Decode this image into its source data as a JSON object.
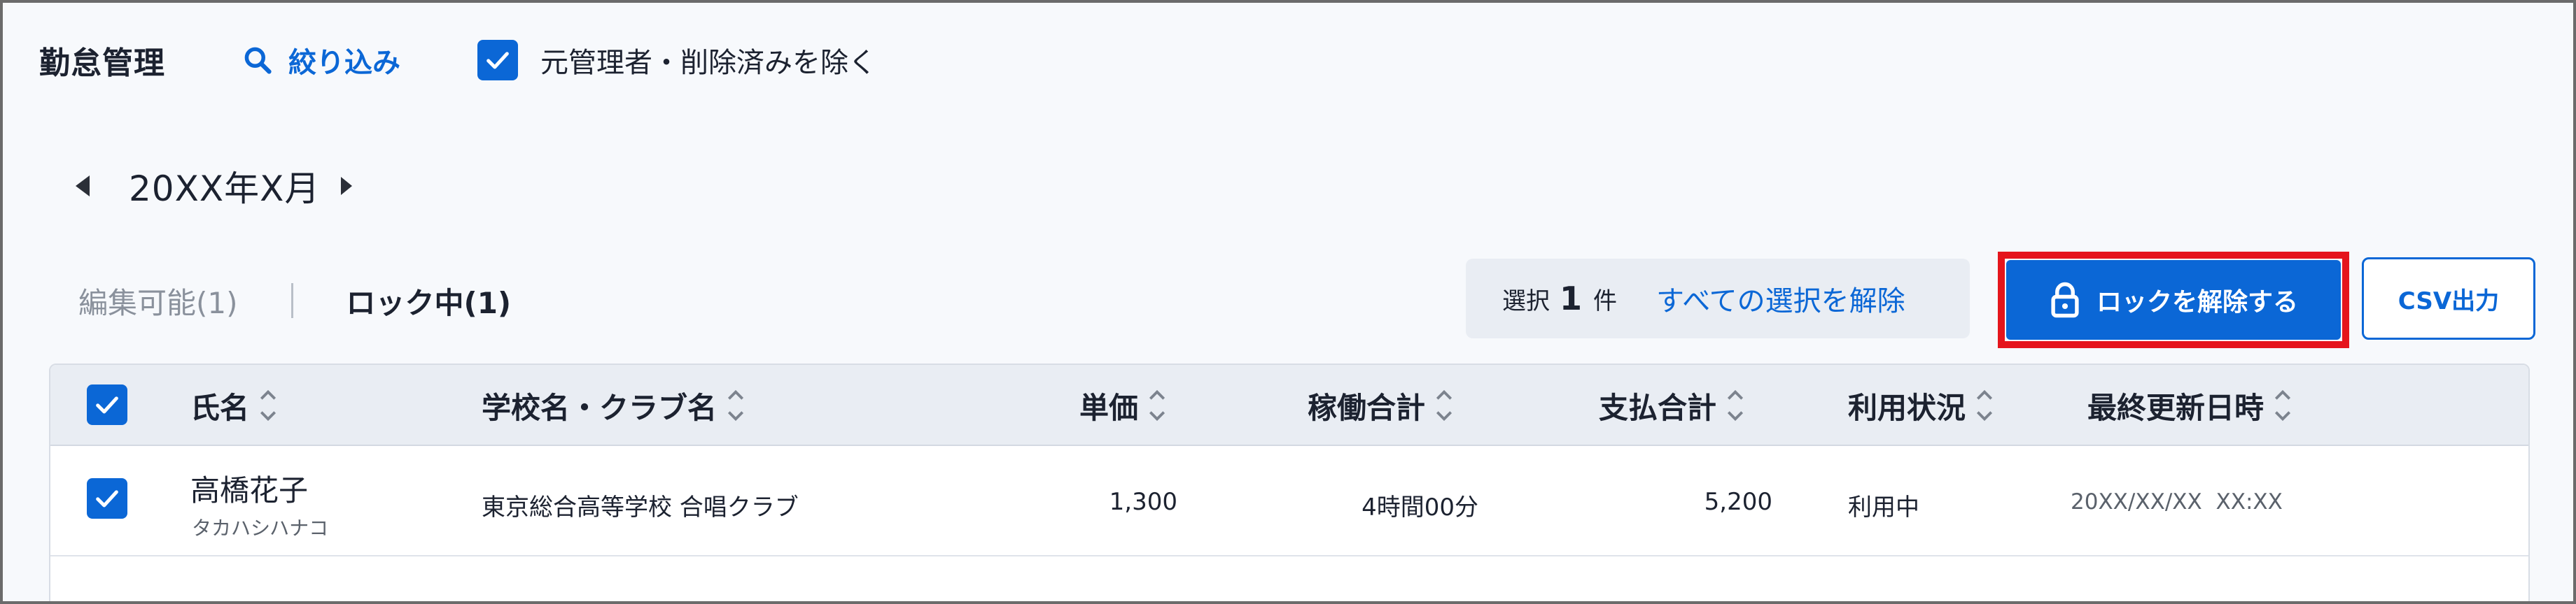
{
  "header": {
    "title": "勤怠管理",
    "filter_label": "絞り込み",
    "exclude_label": "元管理者・削除済みを除く"
  },
  "month_nav": {
    "label": "20XX年X月"
  },
  "tabs": {
    "editable": "編集可能(1)",
    "locked": "ロック中(1)"
  },
  "selection": {
    "prefix": "選択",
    "count": "1",
    "suffix": "件",
    "clear_label": "すべての選択を解除"
  },
  "actions": {
    "unlock_label": "ロックを解除する",
    "csv_label": "CSV出力"
  },
  "table": {
    "columns": [
      "氏名",
      "学校名・クラブ名",
      "単価",
      "稼働合計",
      "支払合計",
      "利用状況",
      "最終更新日時"
    ],
    "rows": [
      {
        "name": "高橋花子",
        "kana": "タカハシハナコ",
        "school": "東京総合高等学校 合唱クラブ",
        "unit_price": "1,300",
        "work_total": "4時間00分",
        "payment_total": "5,200",
        "status": "利用中",
        "updated_at": "20XX/XX/XX  XX:XX"
      }
    ]
  },
  "colors": {
    "accent": "#0b67d6",
    "highlight": "#e5151c"
  }
}
